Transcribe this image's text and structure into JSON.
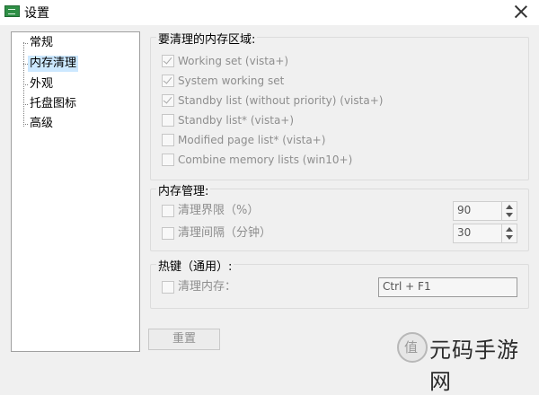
{
  "window": {
    "title": "设置",
    "app_icon": "app-icon",
    "close_icon": "close-icon"
  },
  "sidebar": {
    "items": [
      {
        "label": "常规",
        "selected": false
      },
      {
        "label": "内存清理",
        "selected": true
      },
      {
        "label": "外观",
        "selected": false
      },
      {
        "label": "托盘图标",
        "selected": false
      },
      {
        "label": "高级",
        "selected": false
      }
    ]
  },
  "memory_areas": {
    "title": "要清理的内存区域:",
    "options": [
      {
        "label": "Working set (vista+)",
        "checked": true
      },
      {
        "label": "System working set",
        "checked": true
      },
      {
        "label": "Standby list (without priority) (vista+)",
        "checked": true
      },
      {
        "label": "Standby list* (vista+)",
        "checked": false
      },
      {
        "label": "Modified page list* (vista+)",
        "checked": false
      },
      {
        "label": "Combine memory lists (win10+)",
        "checked": false
      }
    ]
  },
  "memory_management": {
    "title": "内存管理:",
    "limit": {
      "label": "清理界限（%）",
      "checked": false,
      "value": "90"
    },
    "interval": {
      "label": "清理间隔（分钟）",
      "checked": false,
      "value": "30"
    }
  },
  "hotkey": {
    "title": "热键（通用）:",
    "clean": {
      "label": "清理内存：",
      "checked": false,
      "value": "Ctrl + F1"
    }
  },
  "buttons": {
    "reset": "重置"
  },
  "watermark": {
    "text": "元码手游网"
  }
}
